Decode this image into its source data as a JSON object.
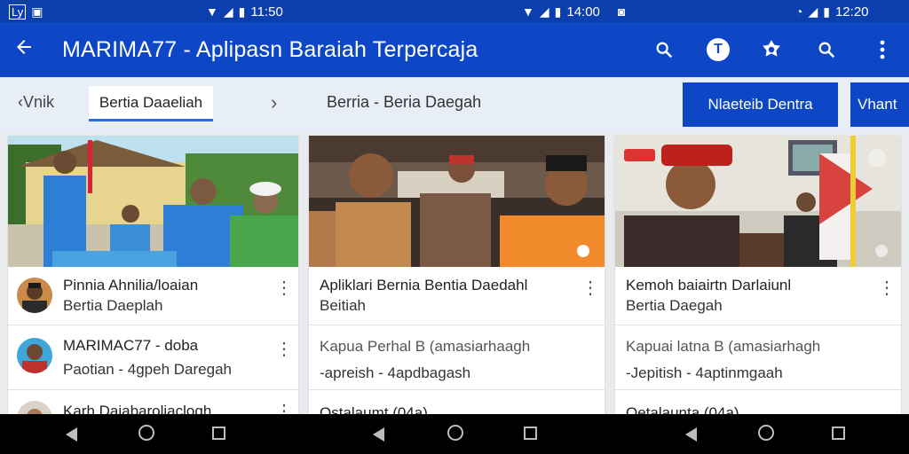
{
  "statusbar": {
    "left": {
      "icons": [
        "carrier-badge-icon",
        "notification-icon"
      ],
      "carrier": "Ly"
    },
    "middle": {
      "time": "11:50"
    },
    "right_mid": {
      "time": "14:00"
    },
    "far_right": {
      "time": "12:20"
    }
  },
  "appbar": {
    "title": "MARIMA77 - Aplipasn Baraiah Terpercaja",
    "back_icon": "arrow-left-icon",
    "actions": [
      "search-icon",
      "profile-badge-icon",
      "star-badge-icon",
      "search-icon",
      "more-vert-icon"
    ],
    "profile_letter": "T"
  },
  "tabs": {
    "back_label": "Vnik",
    "active_label": "Bertia Daaeliah",
    "section_label": "Berria - Beria Daegah",
    "primary_label": "Nlaeteib Dentra",
    "extra_label": "Vhant"
  },
  "columns": [
    {
      "items": [
        {
          "title": "Pinnia Ahnilia/loaian",
          "subtitle": "Bertia Daeplah"
        },
        {
          "title": "MARIMAC77 - doba",
          "subtitle": "Paotian - 4gpeh Daregah"
        },
        {
          "title": "Karh Daiabaroliaclogh",
          "subtitle": ""
        }
      ]
    },
    {
      "items": [
        {
          "title": "Apliklari Bernia Bentia Daedahl",
          "subtitle": "Beitiah"
        },
        {
          "title": "Kapua Perhal B (amasiarhaagh",
          "subtitle": "-apreish - 4apdbagash"
        },
        {
          "title": "Ostalaumt (04a)",
          "subtitle": ""
        }
      ]
    },
    {
      "items": [
        {
          "title": "Kemoh baiairtn Darlaiunl",
          "subtitle": "Bertia Daegah"
        },
        {
          "title": "Kapuai latna B (amasiarhagh",
          "subtitle": "-Jepitish - 4aptinmgaah"
        },
        {
          "title": "Oetalaunta (04a)",
          "subtitle": ""
        }
      ]
    }
  ],
  "colors": {
    "status_bar": "#0b3fae",
    "app_bar": "#0d47c6",
    "tab_strip": "#e8eef8",
    "accent": "#2a6fe0"
  },
  "navbar": {
    "groups": 3,
    "icons": [
      "nav-back-icon",
      "nav-home-icon",
      "nav-recent-icon"
    ]
  }
}
